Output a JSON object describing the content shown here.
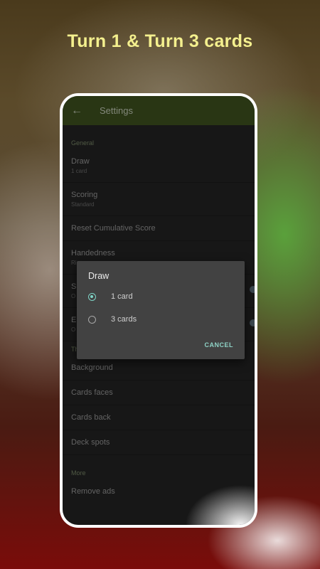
{
  "headline": "Turn 1 & Turn 3 cards",
  "appbar": {
    "title": "Settings",
    "back_icon": "arrow-back-icon"
  },
  "sections": {
    "general": "General",
    "theme": "Theme",
    "more": "More"
  },
  "rows": {
    "draw": {
      "title": "Draw",
      "subtitle": "1 card"
    },
    "scoring": {
      "title": "Scoring",
      "subtitle": "Standard"
    },
    "reset": {
      "title": "Reset Cumulative Score"
    },
    "handedness": {
      "title": "Handedness",
      "subtitle": "Ri"
    },
    "row5": {
      "title": "S",
      "subtitle": "O"
    },
    "row6": {
      "title": "E",
      "subtitle": "O"
    },
    "background": {
      "title": "Background"
    },
    "card_faces": {
      "title": "Cards faces"
    },
    "card_back": {
      "title": "Cards back"
    },
    "deck_spots": {
      "title": "Deck spots"
    },
    "remove_ads": {
      "title": "Remove ads"
    }
  },
  "dialog": {
    "title": "Draw",
    "options": [
      {
        "label": "1 card",
        "selected": true
      },
      {
        "label": "3 cards",
        "selected": false
      }
    ],
    "cancel": "CANCEL"
  },
  "colors": {
    "accent": "#7fd6c8",
    "appbar": "#3f5320",
    "headline": "#f4f08e"
  }
}
